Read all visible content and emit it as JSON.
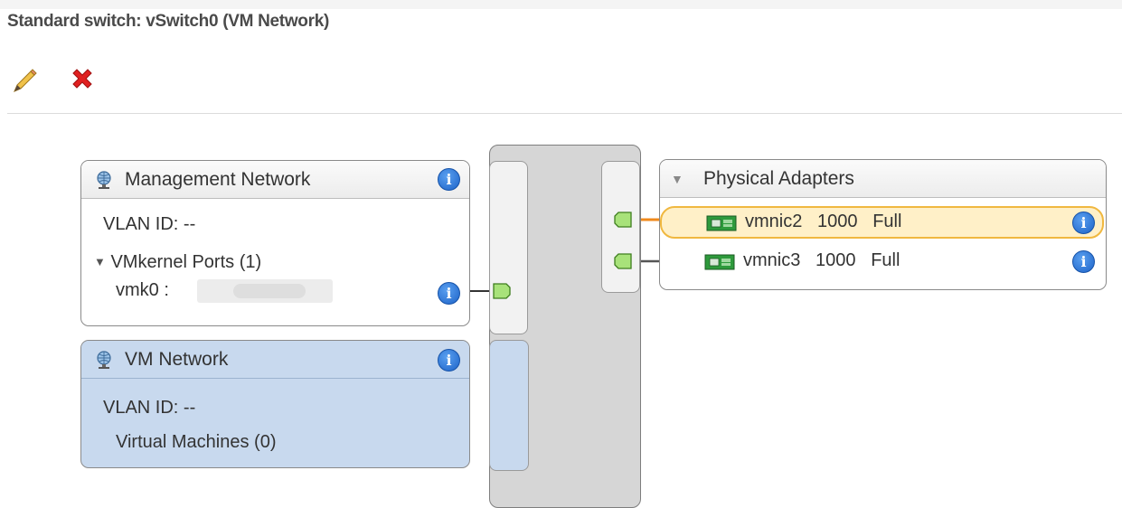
{
  "header": {
    "title": "Standard switch: vSwitch0 (VM Network)"
  },
  "toolbar": {
    "edit_icon": "pencil-icon",
    "remove_icon": "red-x-icon"
  },
  "management_network": {
    "name": "Management Network",
    "vlan_label": "VLAN ID: --",
    "vmkernel_label": "VMkernel Ports (1)",
    "vmk_label": "vmk0 :",
    "icon": "network-globe-icon"
  },
  "vm_network": {
    "name": "VM Network",
    "vlan_label": "VLAN ID: --",
    "vms_label": "Virtual Machines (0)",
    "icon": "network-globe-icon"
  },
  "physical_adapters": {
    "title": "Physical Adapters",
    "adapters": [
      {
        "name": "vmnic2",
        "speed": "1000",
        "duplex": "Full",
        "selected": true
      },
      {
        "name": "vmnic3",
        "speed": "1000",
        "duplex": "Full",
        "selected": false
      }
    ]
  },
  "colors": {
    "active_wire": "#f08a1c",
    "standby_wire": "#555555",
    "vm_network_bg": "#c8d9ee",
    "port_green": "#a8e27a",
    "info_blue": "#1d63c8",
    "selected_row": "#fff0c8"
  }
}
